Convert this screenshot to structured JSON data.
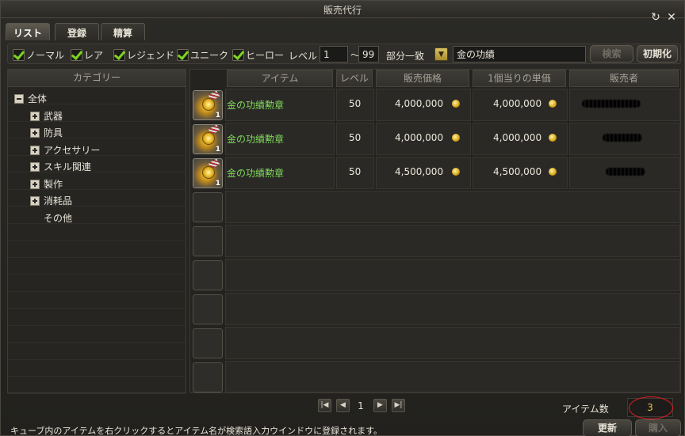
{
  "window": {
    "title": "販売代行"
  },
  "titlebar": {
    "refresh_icon": "refresh-icon",
    "close_icon": "close-icon"
  },
  "tabs": [
    {
      "label": "リスト",
      "active": true
    },
    {
      "label": "登録",
      "active": false
    },
    {
      "label": "精算",
      "active": false
    }
  ],
  "filters": {
    "checkboxes": [
      {
        "label": "ノーマル",
        "checked": true
      },
      {
        "label": "レア",
        "checked": true
      },
      {
        "label": "レジェンド",
        "checked": true
      },
      {
        "label": "ユニーク",
        "checked": true
      },
      {
        "label": "ヒーロー",
        "checked": true
      }
    ],
    "level_label": "レベル",
    "level_min": "1",
    "tilde": "～",
    "level_max": "99",
    "match_label": "部分一致",
    "search_value": "金の功績",
    "search_button": "検索",
    "reset_button": "初期化"
  },
  "categories": {
    "header": "カテゴリー",
    "items": [
      {
        "label": "全体",
        "expander": "minus"
      },
      {
        "label": "武器",
        "expander": "plus"
      },
      {
        "label": "防具",
        "expander": "plus"
      },
      {
        "label": "アクセサリー",
        "expander": "plus"
      },
      {
        "label": "スキル関連",
        "expander": "plus"
      },
      {
        "label": "製作",
        "expander": "plus"
      },
      {
        "label": "消耗品",
        "expander": "plus"
      },
      {
        "label": "その他",
        "expander": "none"
      }
    ]
  },
  "table": {
    "headers": [
      "アイテム",
      "レベル",
      "販売価格",
      "1個当りの単価",
      "販売者"
    ],
    "rows": [
      {
        "name": "金の功績勲章",
        "qty": "1",
        "level": "50",
        "price": "4,000,000",
        "unit_price": "4,000,000"
      },
      {
        "name": "金の功績勲章",
        "qty": "1",
        "level": "50",
        "price": "4,000,000",
        "unit_price": "4,000,000"
      },
      {
        "name": "金の功績勲章",
        "qty": "1",
        "level": "50",
        "price": "4,500,000",
        "unit_price": "4,500,000"
      }
    ],
    "empty_rows": 6
  },
  "pager": {
    "current_page": "1"
  },
  "item_count": {
    "label": "アイテム数",
    "value": "3"
  },
  "footer": {
    "hint": "キューブ内のアイテムを右クリックするとアイテム名が検索語入力ウインドウに登録されます。",
    "refresh_button": "更新",
    "buy_button": "購入"
  },
  "colors": {
    "item_name": "#7fd85a",
    "check": "#7ed321",
    "count": "#e8c44a",
    "annotation_circle": "#e02020"
  }
}
